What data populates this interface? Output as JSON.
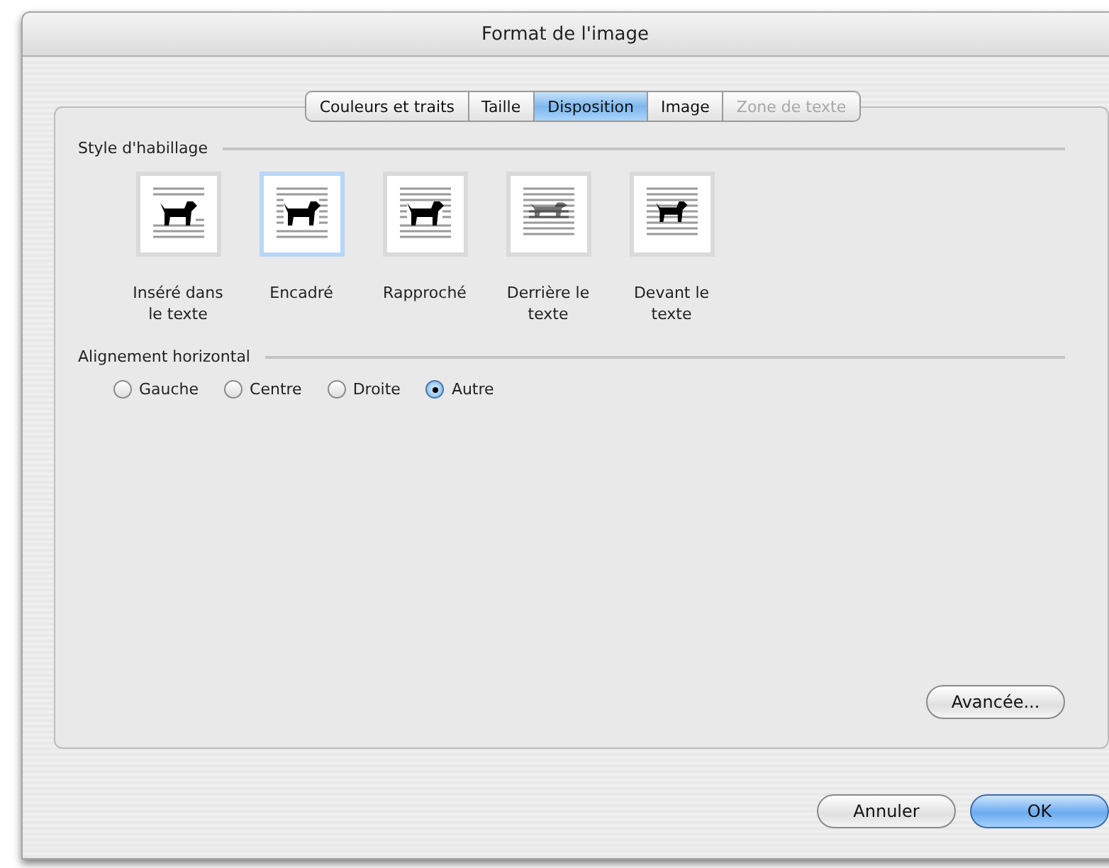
{
  "window": {
    "title": "Format de l'image"
  },
  "tabs": [
    {
      "label": "Couleurs et traits",
      "selected": false,
      "disabled": false
    },
    {
      "label": "Taille",
      "selected": false,
      "disabled": false
    },
    {
      "label": "Disposition",
      "selected": true,
      "disabled": false
    },
    {
      "label": "Image",
      "selected": false,
      "disabled": false
    },
    {
      "label": "Zone de texte",
      "selected": false,
      "disabled": true
    }
  ],
  "wrap_style": {
    "heading": "Style d'habillage",
    "options": [
      {
        "kind": "inline",
        "label": "Inséré dans le texte",
        "selected": false
      },
      {
        "kind": "square",
        "label": "Encadré",
        "selected": true
      },
      {
        "kind": "tight",
        "label": "Rapproché",
        "selected": false
      },
      {
        "kind": "behind",
        "label": "Derrière le texte",
        "selected": false
      },
      {
        "kind": "front",
        "label": "Devant le texte",
        "selected": false
      }
    ]
  },
  "alignment": {
    "heading": "Alignement horizontal",
    "options": [
      {
        "label": "Gauche",
        "selected": false
      },
      {
        "label": "Centre",
        "selected": false
      },
      {
        "label": "Droite",
        "selected": false
      },
      {
        "label": "Autre",
        "selected": true
      }
    ]
  },
  "advanced_button": "Avancée...",
  "buttons": [
    {
      "label": "Annuler",
      "kind": "cancel"
    },
    {
      "label": "OK",
      "kind": "default"
    }
  ]
}
